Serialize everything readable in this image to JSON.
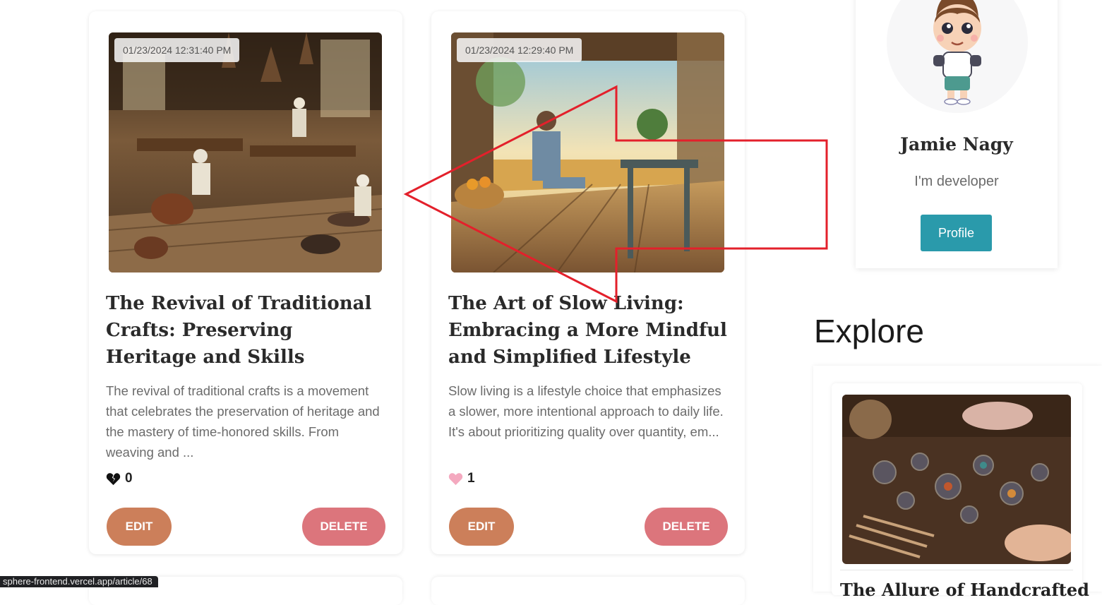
{
  "articles": [
    {
      "timestamp": "01/23/2024 12:31:40 PM",
      "title": "The Revival of Traditional Crafts: Preserving Heritage and Skills",
      "excerpt": "The revival of traditional crafts is a movement that celebrates the preservation of heritage and the mastery of time-honored skills. From weaving and ...",
      "likes": "0",
      "like_icon": "broken-heart-icon",
      "edit_label": "EDIT",
      "delete_label": "DELETE"
    },
    {
      "timestamp": "01/23/2024 12:29:40 PM",
      "title": "The Art of Slow Living: Embracing a More Mindful and Simplified Lifestyle",
      "excerpt": "Slow living is a lifestyle choice that emphasizes a slower, more intentional approach to daily life. It's about prioritizing quality over quantity, em...",
      "likes": "1",
      "like_icon": "heart-icon",
      "edit_label": "EDIT",
      "delete_label": "DELETE"
    }
  ],
  "profile": {
    "name": "Jamie Nagy",
    "bio": "I'm developer",
    "button_label": "Profile"
  },
  "explore": {
    "heading": "Explore",
    "card_title": "The Allure of Handcrafted"
  },
  "status_bar": {
    "url": "sphere-frontend.vercel.app/article/68"
  },
  "colors": {
    "edit_button": "#cc7f5a",
    "delete_button": "#dc757c",
    "profile_button": "#2a9aab",
    "annotation_arrow": "#e3202b",
    "liked_heart": "#f4a9bf"
  }
}
